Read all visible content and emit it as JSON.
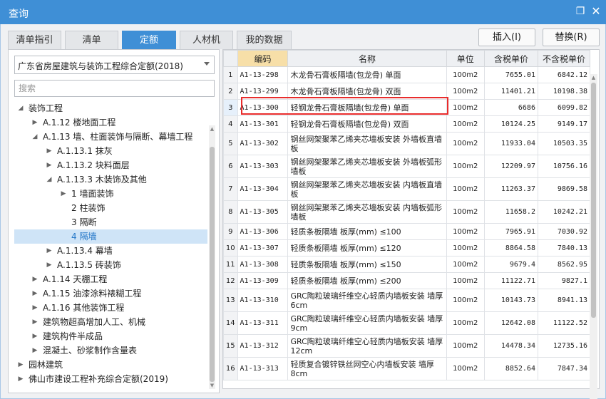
{
  "window": {
    "title": "查询",
    "restore_icon": "restore-icon",
    "close_icon": "close-icon"
  },
  "tabs": [
    {
      "label": "清单指引",
      "active": false
    },
    {
      "label": "清单",
      "active": false
    },
    {
      "label": "定额",
      "active": true
    },
    {
      "label": "人材机",
      "active": false
    },
    {
      "label": "我的数据",
      "active": false
    }
  ],
  "actions": {
    "insert": "插入(I)",
    "replace": "替换(R)"
  },
  "left": {
    "quota_library": "广东省房屋建筑与装饰工程综合定额(2018)",
    "search_placeholder": "搜索",
    "tree": [
      {
        "label": "装饰工程",
        "state": "expanded",
        "selected": false
      },
      {
        "label": "A.1.12 楼地面工程",
        "state": "collapsed",
        "selected": false
      },
      {
        "label": "A.1.13 墙、柱面装饰与隔断、幕墙工程",
        "state": "expanded",
        "selected": false
      },
      {
        "label": "A.1.13.1 抹灰",
        "state": "collapsed",
        "selected": false
      },
      {
        "label": "A.1.13.2 块料面层",
        "state": "collapsed",
        "selected": false
      },
      {
        "label": "A.1.13.3 木装饰及其他",
        "state": "expanded",
        "selected": false
      },
      {
        "label": "1 墙面装饰",
        "state": "collapsed",
        "selected": false
      },
      {
        "label": "2 柱装饰",
        "state": "leaf",
        "selected": false
      },
      {
        "label": "3 隔断",
        "state": "leaf",
        "selected": false
      },
      {
        "label": "4 隔墙",
        "state": "leaf",
        "selected": true
      },
      {
        "label": "A.1.13.4 幕墙",
        "state": "collapsed",
        "selected": false
      },
      {
        "label": "A.1.13.5 砖装饰",
        "state": "collapsed",
        "selected": false
      },
      {
        "label": "A.1.14 天棚工程",
        "state": "collapsed",
        "selected": false
      },
      {
        "label": "A.1.15 油漆涂料裱糊工程",
        "state": "collapsed",
        "selected": false
      },
      {
        "label": "A.1.16 其他装饰工程",
        "state": "collapsed",
        "selected": false
      },
      {
        "label": "建筑物超高增加人工、机械",
        "state": "collapsed",
        "selected": false
      },
      {
        "label": "建筑构件半成品",
        "state": "collapsed",
        "selected": false
      },
      {
        "label": "混凝土、砂浆制作含量表",
        "state": "collapsed",
        "selected": false
      },
      {
        "label": "园林建筑",
        "state": "collapsed",
        "selected": false
      },
      {
        "label": "佛山市建设工程补充综合定额(2019)",
        "state": "collapsed",
        "selected": false
      }
    ]
  },
  "table": {
    "columns": [
      "编码",
      "名称",
      "单位",
      "含税单价",
      "不含税单价"
    ],
    "highlighted_row": 3,
    "rows": [
      {
        "num": "1",
        "code": "A1-13-298",
        "name": "木龙骨石膏板隔墙(包龙骨) 单面",
        "unit": "100m2",
        "tax_price": "7655.01",
        "notax_price": "6842.12",
        "tall": false
      },
      {
        "num": "2",
        "code": "A1-13-299",
        "name": "木龙骨石膏板隔墙(包龙骨) 双面",
        "unit": "100m2",
        "tax_price": "11401.21",
        "notax_price": "10198.38",
        "tall": false
      },
      {
        "num": "3",
        "code": "A1-13-300",
        "name": "轻钢龙骨石膏板隔墙(包龙骨) 单面",
        "unit": "100m2",
        "tax_price": "6686",
        "notax_price": "6099.82",
        "tall": false
      },
      {
        "num": "4",
        "code": "A1-13-301",
        "name": "轻钢龙骨石膏板隔墙(包龙骨) 双面",
        "unit": "100m2",
        "tax_price": "10124.25",
        "notax_price": "9149.17",
        "tall": false
      },
      {
        "num": "5",
        "code": "A1-13-302",
        "name": "钢丝网架聚苯乙烯夹芯墙板安装 外墙板直墙板",
        "unit": "100m2",
        "tax_price": "11933.04",
        "notax_price": "10503.35",
        "tall": true
      },
      {
        "num": "6",
        "code": "A1-13-303",
        "name": "钢丝网架聚苯乙烯夹芯墙板安装 外墙板弧形墙板",
        "unit": "100m2",
        "tax_price": "12209.97",
        "notax_price": "10756.16",
        "tall": true
      },
      {
        "num": "7",
        "code": "A1-13-304",
        "name": "钢丝网架聚苯乙烯夹芯墙板安装 内墙板直墙板",
        "unit": "100m2",
        "tax_price": "11263.37",
        "notax_price": "9869.58",
        "tall": true
      },
      {
        "num": "8",
        "code": "A1-13-305",
        "name": "钢丝网架聚苯乙烯夹芯墙板安装 内墙板弧形墙板",
        "unit": "100m2",
        "tax_price": "11658.2",
        "notax_price": "10242.21",
        "tall": true
      },
      {
        "num": "9",
        "code": "A1-13-306",
        "name": "轻质条板隔墙 板厚(mm) ≤100",
        "unit": "100m2",
        "tax_price": "7965.91",
        "notax_price": "7030.92",
        "tall": false
      },
      {
        "num": "10",
        "code": "A1-13-307",
        "name": "轻质条板隔墙 板厚(mm) ≤120",
        "unit": "100m2",
        "tax_price": "8864.58",
        "notax_price": "7840.13",
        "tall": false
      },
      {
        "num": "11",
        "code": "A1-13-308",
        "name": "轻质条板隔墙 板厚(mm) ≤150",
        "unit": "100m2",
        "tax_price": "9679.4",
        "notax_price": "8562.95",
        "tall": false
      },
      {
        "num": "12",
        "code": "A1-13-309",
        "name": "轻质条板隔墙 板厚(mm) ≤200",
        "unit": "100m2",
        "tax_price": "11122.71",
        "notax_price": "9827.1",
        "tall": false
      },
      {
        "num": "13",
        "code": "A1-13-310",
        "name": "GRC陶粒玻璃纤维空心轻质内墙板安装 墙厚 6cm",
        "unit": "100m2",
        "tax_price": "10143.73",
        "notax_price": "8941.13",
        "tall": true
      },
      {
        "num": "14",
        "code": "A1-13-311",
        "name": "GRC陶粒玻璃纤维空心轻质内墙板安装 墙厚 9cm",
        "unit": "100m2",
        "tax_price": "12642.08",
        "notax_price": "11122.52",
        "tall": true
      },
      {
        "num": "15",
        "code": "A1-13-312",
        "name": "GRC陶粒玻璃纤维空心轻质内墙板安装 墙厚 12cm",
        "unit": "100m2",
        "tax_price": "14478.34",
        "notax_price": "12735.16",
        "tall": true
      },
      {
        "num": "16",
        "code": "A1-13-313",
        "name": "轻质复合镀锌铁丝网空心内墙板安装 墙厚 8cm",
        "unit": "100m2",
        "tax_price": "8852.64",
        "notax_price": "7847.34",
        "tall": true
      }
    ]
  },
  "colors": {
    "accent": "#3f8fd6",
    "selected_bg": "#cfe4f7",
    "code_header_bg": "#f7dfa8",
    "highlight_border": "#e82c2c"
  }
}
